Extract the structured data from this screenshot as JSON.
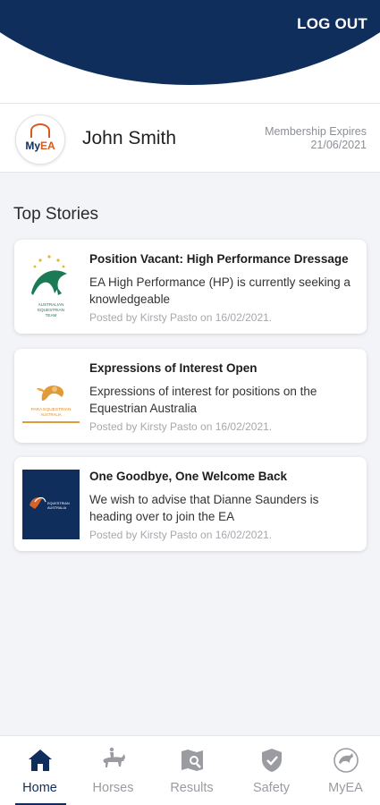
{
  "header": {
    "logout_label": "LOG OUT",
    "bg_color": "#0f2e5c"
  },
  "profile": {
    "avatar_prefix": "My",
    "avatar_suffix": "EA",
    "name": "John Smith",
    "membership_label": "Membership Expires",
    "membership_date": "21/06/2021"
  },
  "stories": {
    "section_title": "Top Stories",
    "items": [
      {
        "title": "Position Vacant: High Performance Dressage",
        "body": "EA High Performance (HP) is currently seeking a knowledgeable",
        "meta": "Posted by Kirsty Pasto on 16/02/2021.",
        "thumb_icon": "australian-equestrian-team-logo",
        "thumb_caption": [
          "AUSTRALIAN",
          "EQUESTRIAN",
          "TEAM"
        ]
      },
      {
        "title": "Expressions of Interest Open",
        "body": "Expressions of interest for positions on the Equestrian Australia",
        "meta": "Posted by Kirsty Pasto on 16/02/2021.",
        "thumb_icon": "para-equestrian-australia-logo",
        "thumb_caption": [
          "PARA EQUESTRIAN",
          "AUSTRALIA"
        ]
      },
      {
        "title": "One Goodbye, One Welcome Back",
        "body": "We wish to advise that Dianne Saunders is heading over to join the EA",
        "meta": "Posted by Kirsty Pasto on 16/02/2021.",
        "thumb_icon": "equestrian-australia-logo",
        "thumb_caption": [
          "EQUESTRIAN",
          "AUSTRALIA"
        ]
      }
    ]
  },
  "tabs": [
    {
      "label": "Home",
      "icon": "home-icon",
      "active": true
    },
    {
      "label": "Horses",
      "icon": "horse-rider-icon",
      "active": false
    },
    {
      "label": "Results",
      "icon": "results-icon",
      "active": false
    },
    {
      "label": "Safety",
      "icon": "safety-shield-icon",
      "active": false
    },
    {
      "label": "MyEA",
      "icon": "myea-icon",
      "active": false
    }
  ]
}
